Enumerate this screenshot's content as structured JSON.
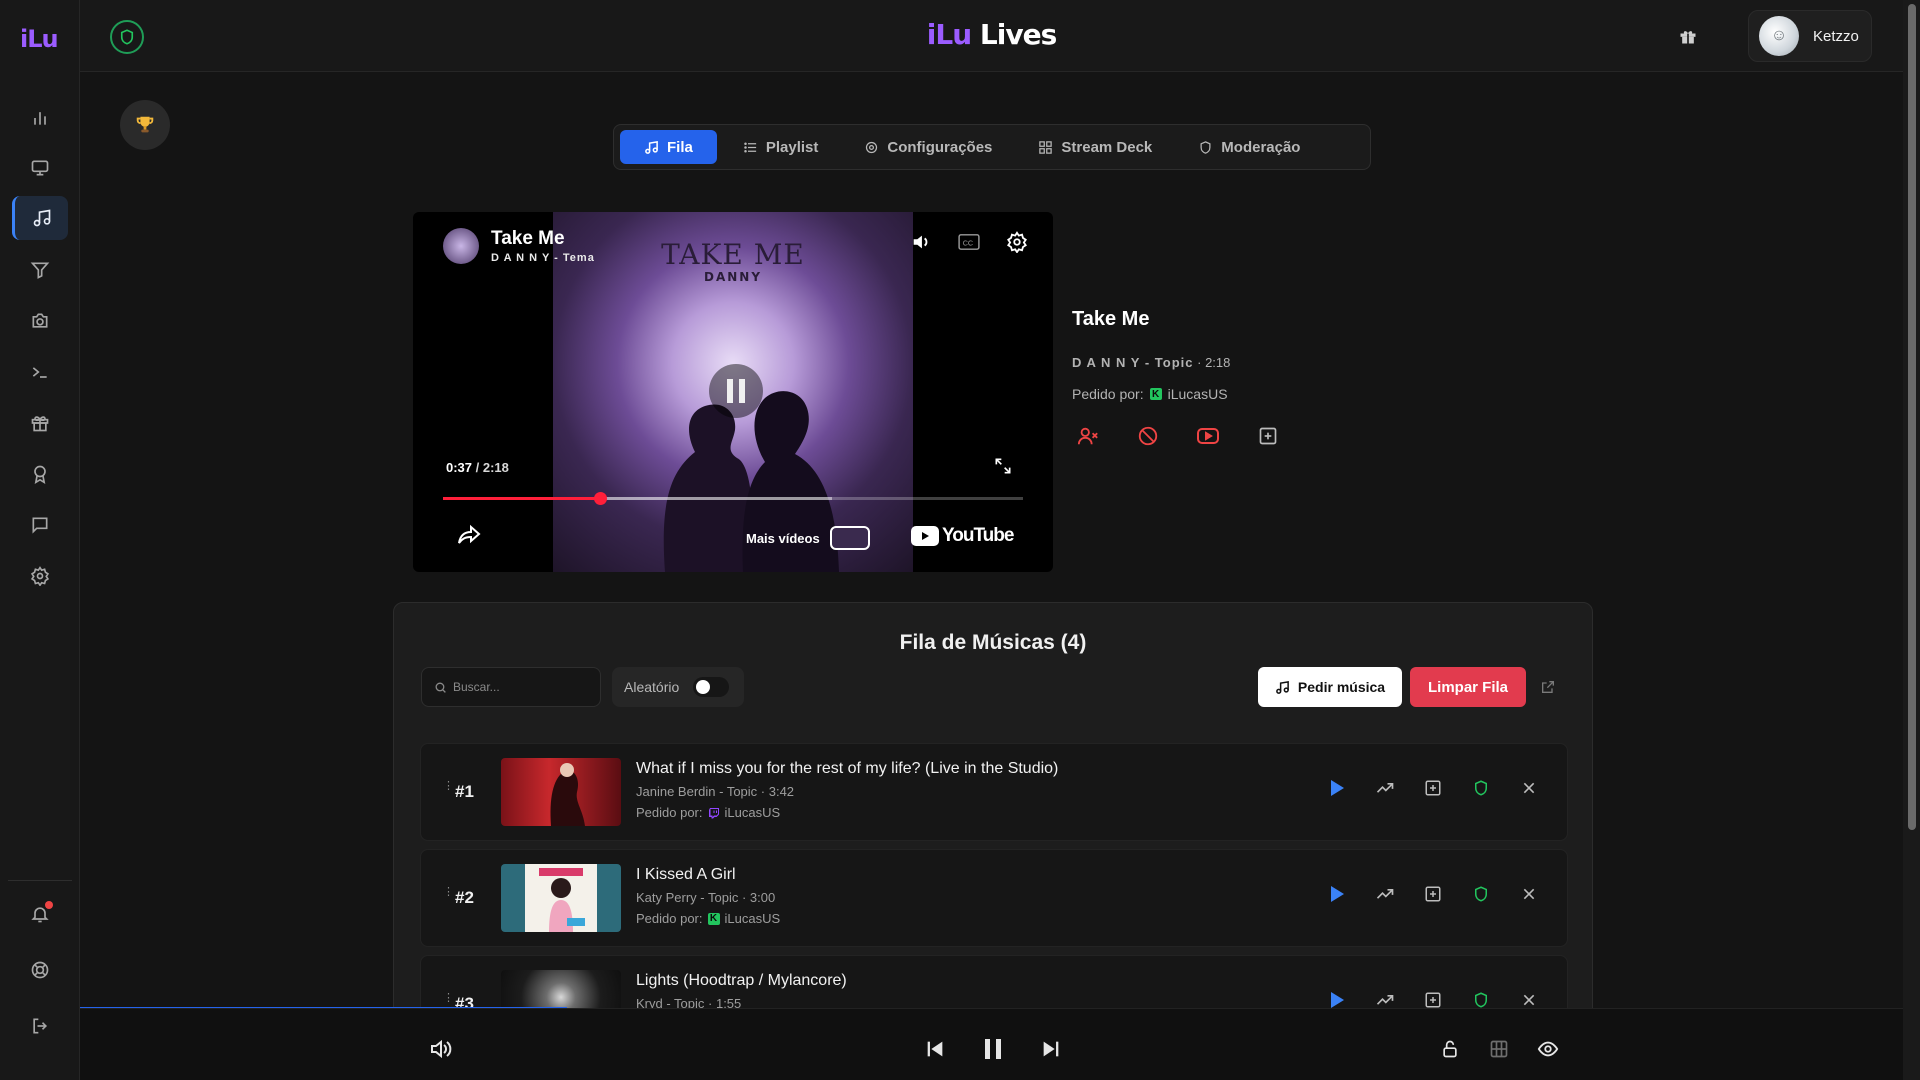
{
  "app": {
    "brand_ilu": "iLu",
    "brand_lives": "Lives",
    "sidebar_logo": "iLu",
    "user": {
      "name": "Ketzzo"
    }
  },
  "sidebar": {
    "items": [
      {
        "name": "chart-icon",
        "active": false
      },
      {
        "name": "monitor-icon",
        "active": false
      },
      {
        "name": "music-note-icon",
        "active": true
      },
      {
        "name": "filter-icon",
        "active": false
      },
      {
        "name": "camera-icon",
        "active": false
      },
      {
        "name": "terminal-icon",
        "active": false
      },
      {
        "name": "gift-icon",
        "active": false
      },
      {
        "name": "award-icon",
        "active": false
      },
      {
        "name": "chat-icon",
        "active": false
      },
      {
        "name": "settings-icon",
        "active": false
      }
    ],
    "bottom_items": [
      "bell-icon",
      "lifebuoy-icon",
      "logout-icon"
    ]
  },
  "tabs": [
    {
      "label": "Fila",
      "icon": "music-note-icon",
      "active": true
    },
    {
      "label": "Playlist",
      "icon": "list-icon",
      "active": false
    },
    {
      "label": "Configurações",
      "icon": "gear-icon",
      "active": false
    },
    {
      "label": "Stream Deck",
      "icon": "grid-icon",
      "active": false
    },
    {
      "label": "Moderação",
      "icon": "shield-icon",
      "active": false
    }
  ],
  "player": {
    "title": "Take Me",
    "channel": "D A N N Y - Tema",
    "cover_title": "TAKE ME",
    "cover_artist": "DANNY",
    "time_current": "0:37",
    "time_separator": " / ",
    "time_total": "2:18",
    "progress_fraction": 0.27,
    "buffer_fraction": 0.67,
    "more_videos": "Mais vídeos",
    "youtube_label": "YouTube"
  },
  "now_playing": {
    "title": "Take Me",
    "channel": "D A N N Y - Topic",
    "duration": "2:18",
    "requested_label": "Pedido por:",
    "requested_by": "iLucasUS"
  },
  "queue": {
    "title": "Fila de Músicas (4)",
    "search_placeholder": "Buscar...",
    "random_label": "Aleatório",
    "request_button": "Pedir música",
    "clear_button": "Limpar Fila",
    "items": [
      {
        "num": "#1",
        "title": "What if I miss you for the rest of my life? (Live in the Studio)",
        "channel": "Janine Berdin - Topic",
        "duration": "3:42",
        "requested_label": "Pedido por:",
        "requested_by": "iLucasUS",
        "platform": "twitch"
      },
      {
        "num": "#2",
        "title": "I Kissed A Girl",
        "channel": "Katy Perry - Topic",
        "duration": "3:00",
        "requested_label": "Pedido por:",
        "requested_by": "iLucasUS",
        "platform": "kick"
      },
      {
        "num": "#3",
        "title": "Lights (Hoodtrap / Mylancore)",
        "channel": "Kryd - Topic",
        "duration": "1:55"
      }
    ]
  },
  "colors": {
    "accent": "#2563eb",
    "brand": "#9b5cff",
    "danger": "#e23b4e",
    "success": "#22c55e"
  }
}
